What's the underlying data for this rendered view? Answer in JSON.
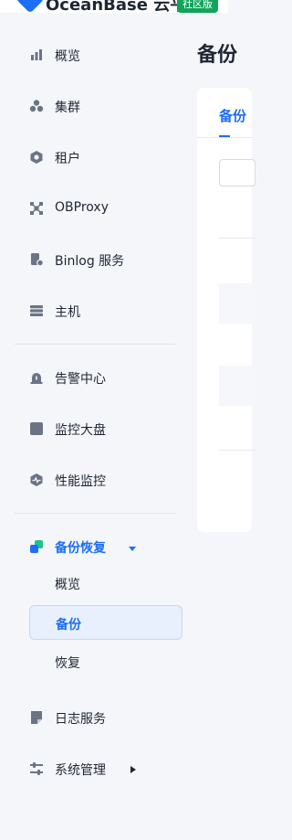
{
  "header": {
    "app_name": "OceanBase 云平台",
    "edition_badge": "社区版"
  },
  "sidebar": {
    "items": [
      {
        "label": "概览",
        "icon": "bar-chart-icon"
      },
      {
        "label": "集群",
        "icon": "cluster-icon"
      },
      {
        "label": "租户",
        "icon": "tenant-icon"
      },
      {
        "label": "OBProxy",
        "icon": "proxy-icon"
      },
      {
        "label": "Binlog 服务",
        "icon": "binlog-icon"
      },
      {
        "label": "主机",
        "icon": "host-icon"
      },
      {
        "label": "告警中心",
        "icon": "alarm-icon"
      },
      {
        "label": "监控大盘",
        "icon": "dashboard-icon"
      },
      {
        "label": "性能监控",
        "icon": "performance-icon"
      }
    ],
    "backup_group": {
      "label": "备份恢复",
      "icon": "backup-icon",
      "expanded": true,
      "children": [
        {
          "label": "概览",
          "active": false
        },
        {
          "label": "备份",
          "active": true
        },
        {
          "label": "恢复",
          "active": false
        }
      ]
    },
    "log_service": {
      "label": "日志服务",
      "icon": "log-icon"
    },
    "system_management": {
      "label": "系统管理",
      "icon": "settings-sliders-icon"
    }
  },
  "main": {
    "title": "备份",
    "active_tab": "备份"
  },
  "colors": {
    "accent": "#1e6ef4",
    "sidebar_bg": "#f4f6fa",
    "badge": "#0fa45a"
  }
}
